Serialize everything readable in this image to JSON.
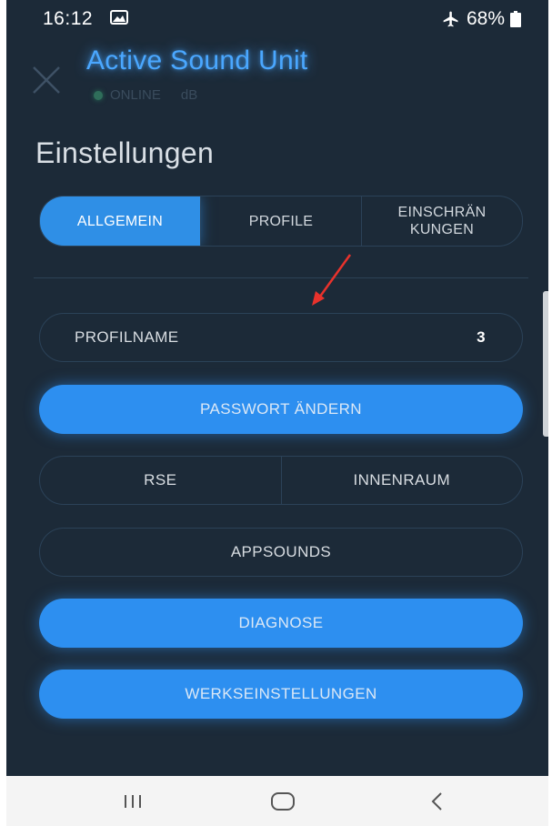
{
  "status_bar": {
    "time": "16:12",
    "battery": "68%",
    "icons": [
      "image-icon",
      "airplane-icon",
      "battery-icon"
    ]
  },
  "header": {
    "title": "Active Sound Unit",
    "status": "ONLINE",
    "unit": "dB",
    "close_icon": "close-icon"
  },
  "page_title": "Einstellungen",
  "tabs": [
    {
      "label": "ALLGEMEIN",
      "active": true
    },
    {
      "label": "PROFILE",
      "active": false
    },
    {
      "label": "EINSCHRÄN\nKUNGEN",
      "active": false
    }
  ],
  "settings": {
    "profile_name_label": "PROFILNAME",
    "profile_name_value": "3",
    "change_password": "PASSWORT ÄNDERN",
    "sound_options": [
      "RSE",
      "INNENRAUM"
    ],
    "app_sounds": "APPSOUNDS",
    "diagnose": "DIAGNOSE",
    "factory_settings": "WERKSEINSTELLUNGEN"
  },
  "nav_bar": {
    "icons": [
      "recent-apps-icon",
      "home-icon",
      "back-icon"
    ]
  },
  "colors": {
    "background": "#1c2a38",
    "accent": "#2d8ff0",
    "title": "#4aa7ff",
    "annotation": "#e8322c"
  }
}
